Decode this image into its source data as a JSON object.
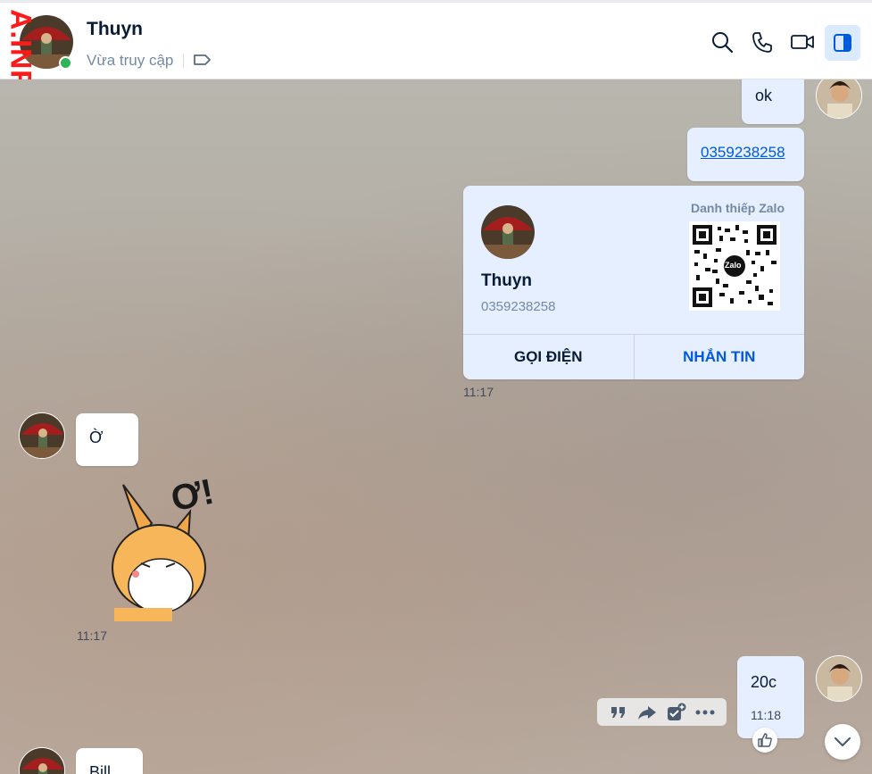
{
  "header": {
    "contact_name": "Thuyn",
    "status": "Vừa truy cập",
    "watermark": "A.INFO",
    "icons": [
      "search-icon",
      "phone-icon",
      "video-call-icon",
      "toggle-sidebar-icon"
    ]
  },
  "messages": {
    "out_ok": "ok",
    "out_phone_link": "0359238258",
    "card": {
      "title": "Danh thiếp Zalo",
      "name": "Thuyn",
      "phone": "0359238258",
      "qr_logo": "Zalo",
      "call_label": "GỌI ĐIỆN",
      "message_label": "NHẮN TIN"
    },
    "card_time": "11:17",
    "in_text": "Ờ",
    "sticker_text": "Ơ!",
    "sticker_time": "11:17",
    "out_last": "20c",
    "out_last_time": "11:18",
    "in_partial": "Bill"
  },
  "toolbar": {
    "icons": [
      "quote-icon",
      "forward-icon",
      "add-task-icon",
      "more-icon"
    ]
  },
  "colors": {
    "accent": "#005ae0",
    "online": "#2fb45a",
    "bubble_out": "#e5efff",
    "bubble_in": "#ffffff",
    "watermark": "#ff1a1a"
  }
}
